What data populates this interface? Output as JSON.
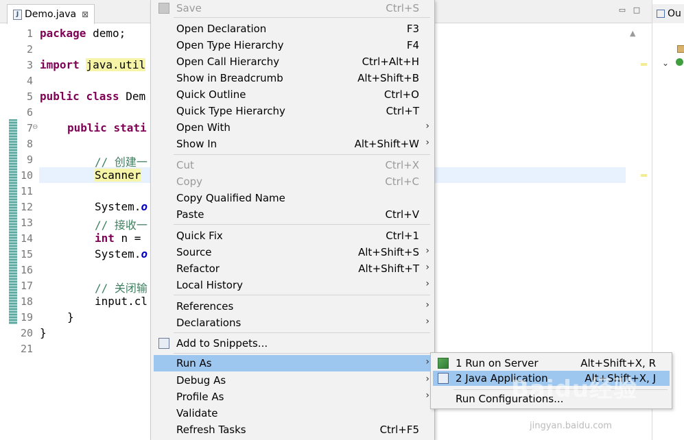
{
  "editor": {
    "tab_title": "Demo.java",
    "tab_close": "⊠",
    "minimize": "▭",
    "maximize": "□",
    "line_numbers": [
      "1",
      "2",
      "3",
      "4",
      "5",
      "6",
      "7",
      "8",
      "9",
      "10",
      "11",
      "12",
      "13",
      "14",
      "15",
      "16",
      "17",
      "18",
      "19",
      "20",
      "21"
    ],
    "lines": {
      "l1_kw": "package",
      "l1_rest": " demo;",
      "l3_kw": "import",
      "l3_rest": "java.util",
      "l5_kw1": "public",
      "l5_kw2": "class",
      "l5_rest": " Dem",
      "l7_kw1": "public",
      "l7_kw2": "stati",
      "l9": "// 创建一",
      "l10": "Scanner",
      "l12_a": "System.",
      "l12_b": "o",
      "l13": "// 接收一",
      "l14_kw": "int",
      "l14_rest": " n =",
      "l15_a": "System.",
      "l15_b": "o",
      "l17": "// 关闭输",
      "l18": "input.cl",
      "l19": "}",
      "l20": "}"
    }
  },
  "outline": {
    "tab_title": "Ou"
  },
  "context_menu": {
    "items": [
      {
        "label": "Save",
        "shortcut": "Ctrl+S"
      },
      {
        "label": "Open Declaration",
        "shortcut": "F3"
      },
      {
        "label": "Open Type Hierarchy",
        "shortcut": "F4"
      },
      {
        "label": "Open Call Hierarchy",
        "shortcut": "Ctrl+Alt+H"
      },
      {
        "label": "Show in Breadcrumb",
        "shortcut": "Alt+Shift+B"
      },
      {
        "label": "Quick Outline",
        "shortcut": "Ctrl+O"
      },
      {
        "label": "Quick Type Hierarchy",
        "shortcut": "Ctrl+T"
      },
      {
        "label": "Open With",
        "shortcut": ""
      },
      {
        "label": "Show In",
        "shortcut": "Alt+Shift+W"
      },
      {
        "label": "Cut",
        "shortcut": "Ctrl+X"
      },
      {
        "label": "Copy",
        "shortcut": "Ctrl+C"
      },
      {
        "label": "Copy Qualified Name",
        "shortcut": ""
      },
      {
        "label": "Paste",
        "shortcut": "Ctrl+V"
      },
      {
        "label": "Quick Fix",
        "shortcut": "Ctrl+1"
      },
      {
        "label": "Source",
        "shortcut": "Alt+Shift+S"
      },
      {
        "label": "Refactor",
        "shortcut": "Alt+Shift+T"
      },
      {
        "label": "Local History",
        "shortcut": ""
      },
      {
        "label": "References",
        "shortcut": ""
      },
      {
        "label": "Declarations",
        "shortcut": ""
      },
      {
        "label": "Add to Snippets...",
        "shortcut": ""
      },
      {
        "label": "Run As",
        "shortcut": ""
      },
      {
        "label": "Debug As",
        "shortcut": ""
      },
      {
        "label": "Profile As",
        "shortcut": ""
      },
      {
        "label": "Validate",
        "shortcut": ""
      },
      {
        "label": "Refresh Tasks",
        "shortcut": "Ctrl+F5"
      }
    ],
    "arrow": "›"
  },
  "run_as_submenu": {
    "items": [
      {
        "label": "1 Run on Server",
        "shortcut": "Alt+Shift+X, R"
      },
      {
        "label": "2 Java Application",
        "shortcut": "Alt+Shift+X, J"
      },
      {
        "label": "Run Configurations...",
        "shortcut": ""
      }
    ]
  },
  "watermark": {
    "brand": "Baidu经验",
    "url": "jingyan.baidu.com"
  },
  "colors": {
    "selection": "#9ec7ef",
    "menu_bg": "#f2f2f2",
    "keyword": "#7f0055",
    "comment": "#3f7f5f"
  }
}
